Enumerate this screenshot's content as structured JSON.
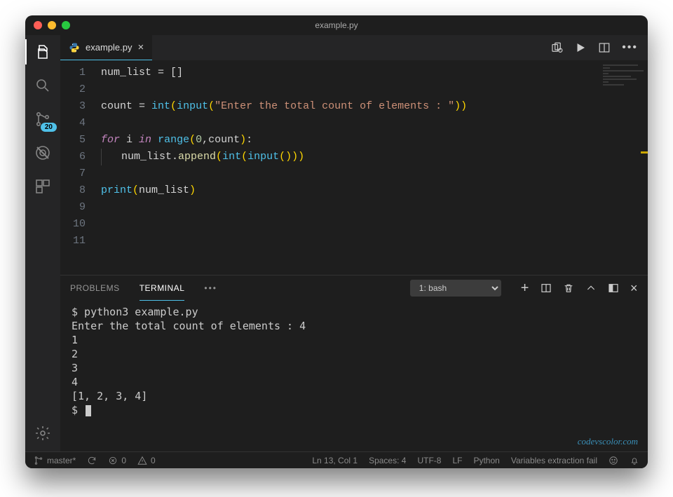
{
  "window": {
    "title": "example.py"
  },
  "tab": {
    "filename": "example.py"
  },
  "activity": {
    "badge": "20"
  },
  "code": {
    "lines": [
      {
        "n": "1",
        "tokens": [
          [
            "var",
            "num_list"
          ],
          [
            "op",
            " = "
          ],
          [
            "punct",
            "[]"
          ]
        ]
      },
      {
        "n": "2",
        "tokens": []
      },
      {
        "n": "3",
        "tokens": [
          [
            "var",
            "count"
          ],
          [
            "op",
            " = "
          ],
          [
            "builtin",
            "int"
          ],
          [
            "brace",
            "("
          ],
          [
            "builtin",
            "input"
          ],
          [
            "brace",
            "("
          ],
          [
            "str",
            "\"Enter the total count of elements : \""
          ],
          [
            "brace",
            "))"
          ]
        ]
      },
      {
        "n": "4",
        "tokens": []
      },
      {
        "n": "5",
        "tokens": [
          [
            "kw",
            "for"
          ],
          [
            "var",
            " i "
          ],
          [
            "kw",
            "in"
          ],
          [
            "op",
            " "
          ],
          [
            "builtin",
            "range"
          ],
          [
            "brace",
            "("
          ],
          [
            "num",
            "0"
          ],
          [
            "punct",
            ","
          ],
          [
            "var",
            "count"
          ],
          [
            "brace",
            ")"
          ],
          [
            "punct",
            ":"
          ]
        ]
      },
      {
        "n": "6",
        "tokens": [
          [
            "indent",
            ""
          ],
          [
            "var",
            "num_list"
          ],
          [
            "punct",
            "."
          ],
          [
            "fn",
            "append"
          ],
          [
            "brace",
            "("
          ],
          [
            "builtin",
            "int"
          ],
          [
            "brace",
            "("
          ],
          [
            "builtin",
            "input"
          ],
          [
            "brace",
            "()))"
          ]
        ]
      },
      {
        "n": "7",
        "tokens": []
      },
      {
        "n": "8",
        "tokens": [
          [
            "builtin",
            "print"
          ],
          [
            "brace",
            "("
          ],
          [
            "var",
            "num_list"
          ],
          [
            "brace",
            ")"
          ]
        ]
      },
      {
        "n": "9",
        "tokens": []
      },
      {
        "n": "10",
        "tokens": []
      },
      {
        "n": "11",
        "tokens": []
      }
    ]
  },
  "panel": {
    "tabs": {
      "problems": "PROBLEMS",
      "terminal": "TERMINAL"
    },
    "select": "1: bash",
    "terminal_lines": [
      "$ python3 example.py",
      "Enter the total count of elements : 4",
      "1",
      "2",
      "3",
      "4",
      "[1, 2, 3, 4]",
      "$ "
    ]
  },
  "status": {
    "branch": "master*",
    "errors": "0",
    "warnings": "0",
    "cursor": "Ln 13, Col 1",
    "spaces": "Spaces: 4",
    "encoding": "UTF-8",
    "eol": "LF",
    "lang": "Python",
    "msg": "Variables extraction fail"
  },
  "watermark": "codevscolor.com"
}
